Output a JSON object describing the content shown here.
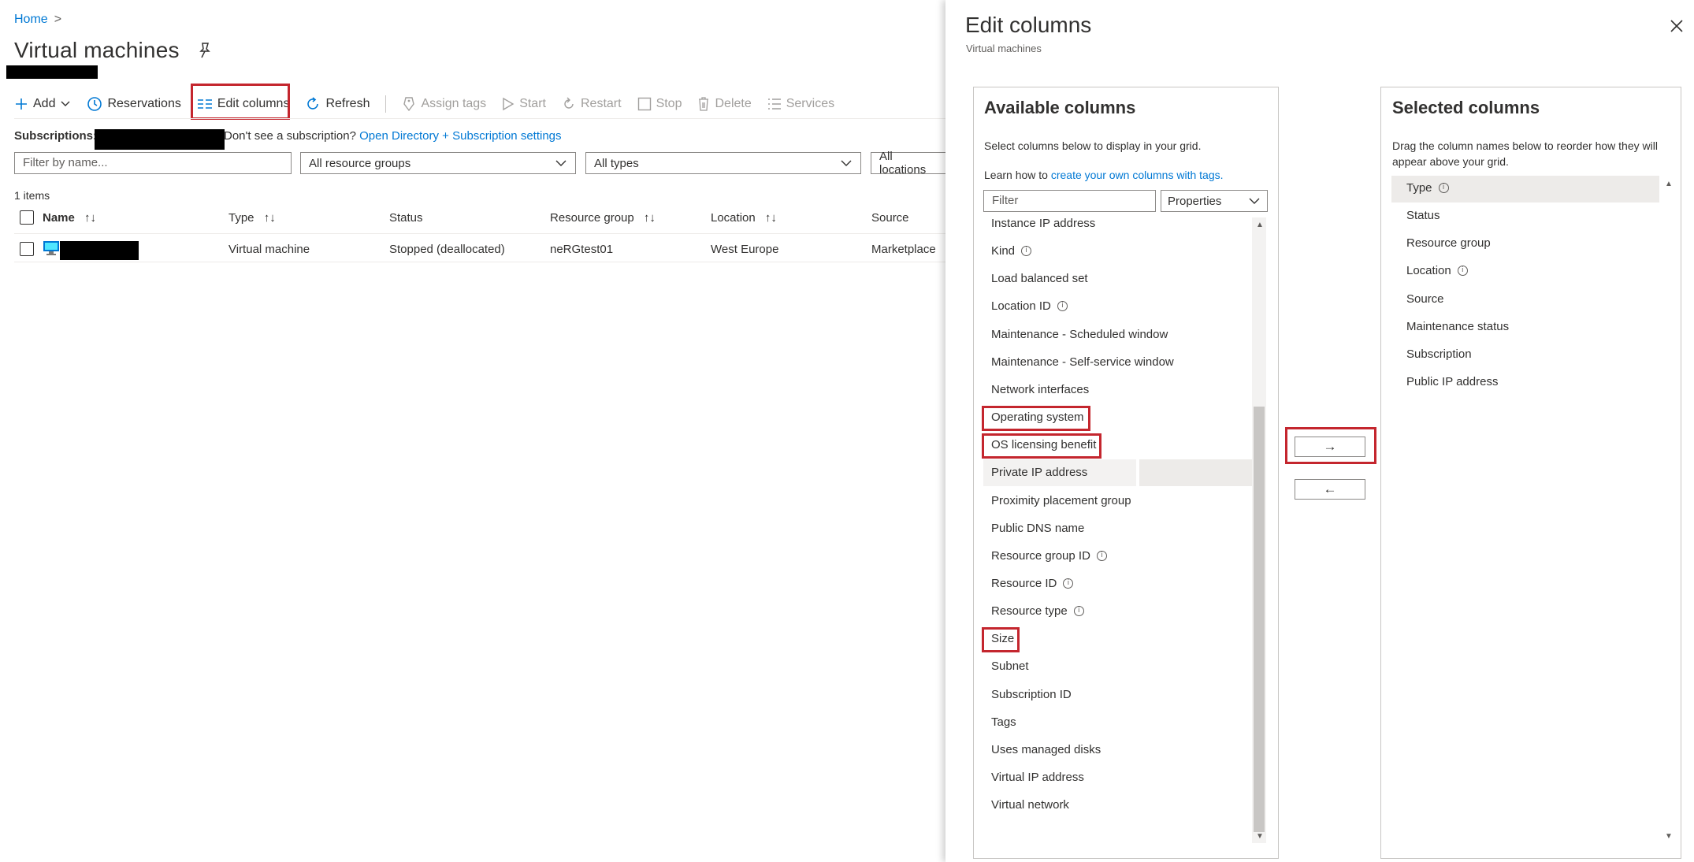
{
  "breadcrumb": {
    "home": "Home",
    "sep": ">"
  },
  "page": {
    "title": "Virtual machines"
  },
  "toolbar": {
    "add": "Add",
    "reservations": "Reservations",
    "edit_columns": "Edit columns",
    "refresh": "Refresh",
    "assign_tags": "Assign tags",
    "start": "Start",
    "restart": "Restart",
    "stop": "Stop",
    "delete": "Delete",
    "services": "Services"
  },
  "subscriptions": {
    "label": "Subscriptions:",
    "hint": "Don't see a subscription?",
    "link": "Open Directory + Subscription settings"
  },
  "filters": {
    "name_placeholder": "Filter by name...",
    "resource_groups": "All resource groups",
    "types": "All types",
    "locations": "All locations"
  },
  "table": {
    "count": "1 items",
    "headers": [
      "Name",
      "Type",
      "Status",
      "Resource group",
      "Location",
      "Source"
    ],
    "sort_glyph": "↑↓",
    "row": {
      "type": "Virtual machine",
      "status": "Stopped (deallocated)",
      "resource_group": "neRGtest01",
      "location": "West Europe",
      "source": "Marketplace"
    }
  },
  "panel": {
    "title": "Edit columns",
    "subtitle": "Virtual machines",
    "available": {
      "title": "Available columns",
      "desc": "Select columns below to display in your grid.",
      "learn_prefix": "Learn how to ",
      "learn_link": "create your own columns with tags.",
      "filter_placeholder": "Filter",
      "properties_label": "Properties",
      "items": [
        {
          "label": "Instance IP address",
          "info": false
        },
        {
          "label": "Kind",
          "info": true
        },
        {
          "label": "Load balanced set",
          "info": false
        },
        {
          "label": "Location ID",
          "info": true
        },
        {
          "label": "Maintenance - Scheduled window",
          "info": false
        },
        {
          "label": "Maintenance - Self-service window",
          "info": false
        },
        {
          "label": "Network interfaces",
          "info": false
        },
        {
          "label": "Operating system",
          "info": false
        },
        {
          "label": "OS licensing benefit",
          "info": false
        },
        {
          "label": "Private IP address",
          "info": false
        },
        {
          "label": "Proximity placement group",
          "info": false
        },
        {
          "label": "Public DNS name",
          "info": false
        },
        {
          "label": "Resource group ID",
          "info": true
        },
        {
          "label": "Resource ID",
          "info": true
        },
        {
          "label": "Resource type",
          "info": true
        },
        {
          "label": "Size",
          "info": false
        },
        {
          "label": "Subnet",
          "info": false
        },
        {
          "label": "Subscription ID",
          "info": false
        },
        {
          "label": "Tags",
          "info": false
        },
        {
          "label": "Uses managed disks",
          "info": false
        },
        {
          "label": "Virtual IP address",
          "info": false
        },
        {
          "label": "Virtual network",
          "info": false
        }
      ]
    },
    "selected": {
      "title": "Selected columns",
      "desc": "Drag the column names below to reorder how they will appear above your grid.",
      "items": [
        {
          "label": "Type",
          "info": true
        },
        {
          "label": "Status",
          "info": false
        },
        {
          "label": "Resource group",
          "info": false
        },
        {
          "label": "Location",
          "info": true
        },
        {
          "label": "Source",
          "info": false
        },
        {
          "label": "Maintenance status",
          "info": false
        },
        {
          "label": "Subscription",
          "info": false
        },
        {
          "label": "Public IP address",
          "info": false
        }
      ]
    },
    "add_arrow": "→",
    "remove_arrow": "←",
    "info_glyph": "i"
  },
  "colors": {
    "accent": "#0078d4",
    "highlight_box": "#c4262e",
    "text": "#323130"
  }
}
